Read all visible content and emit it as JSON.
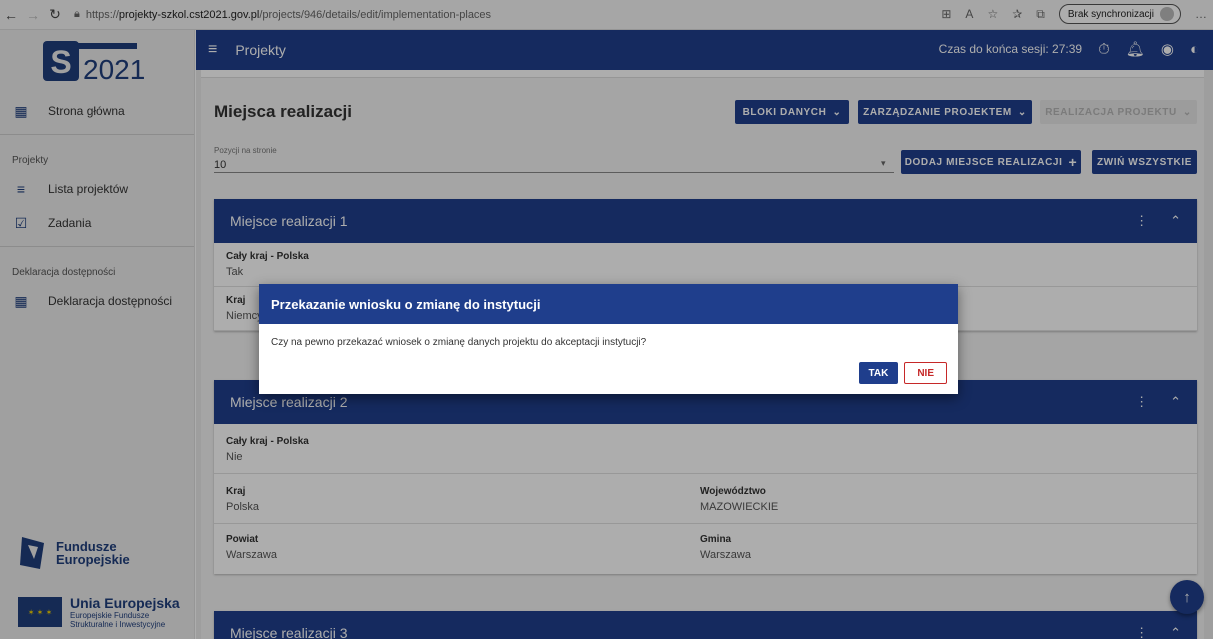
{
  "browser": {
    "url_prefix": "https://",
    "url_host": "projekty-szkol.cst2021.gov.pl",
    "url_path": "/projects/946/details/edit/implementation-places",
    "sync_label": "Brak synchronizacji"
  },
  "sidebar": {
    "logo_text": "2021",
    "items": [
      {
        "label": "Strona główna",
        "icon": "dashboard-icon"
      },
      {
        "label": "Lista projektów",
        "icon": "list-icon"
      },
      {
        "label": "Zadania",
        "icon": "task-icon"
      },
      {
        "label": "Deklaracja dostępności",
        "icon": "dashboard-icon"
      }
    ],
    "sections": [
      "Projekty",
      "Deklaracja dostępności"
    ],
    "fe_logo": {
      "line1": "Fundusze",
      "line2": "Europejskie"
    },
    "ue_logo": {
      "title": "Unia Europejska",
      "sub1": "Europejskie Fundusze",
      "sub2": "Strukturalne i Inwestycyjne"
    }
  },
  "topbar": {
    "title": "Projekty",
    "session_label": "Czas do końca sesji: 27:39"
  },
  "page": {
    "title": "Miejsca realizacji",
    "buttons": {
      "data_blocks": "BLOKI DANYCH",
      "project_management": "ZARZĄDZANIE PROJEKTEM",
      "project_implementation": "REALIZACJA PROJEKTU",
      "add_place": "DODAJ MIEJSCE REALIZACJI",
      "collapse_all": "ZWIŃ WSZYSTKIE"
    },
    "per_page": {
      "label": "Pozycji na stronie",
      "value": "10"
    }
  },
  "cards": [
    {
      "title": "Miejsce realizacji 1",
      "rows": [
        [
          {
            "label": "Cały kraj - Polska",
            "value": "Tak"
          }
        ],
        [
          {
            "label": "Kraj",
            "value": "Niemcy"
          }
        ]
      ]
    },
    {
      "title": "Miejsce realizacji 2",
      "rows": [
        [
          {
            "label": "Cały kraj - Polska",
            "value": "Nie"
          }
        ],
        [
          {
            "label": "Kraj",
            "value": "Polska"
          },
          {
            "label": "Województwo",
            "value": "MAZOWIECKIE"
          }
        ],
        [
          {
            "label": "Powiat",
            "value": "Warszawa"
          },
          {
            "label": "Gmina",
            "value": "Warszawa"
          }
        ]
      ]
    },
    {
      "title": "Miejsce realizacji 3",
      "rows": []
    }
  ],
  "dialog": {
    "title": "Przekazanie wniosku o zmianę do instytucji",
    "message": "Czy na pewno przekazać wniosek o zmianę danych projektu do akceptacji instytucji?",
    "yes_label": "TAK",
    "no_label": "NIE"
  },
  "colors": {
    "primary": "#1f3e8c",
    "danger": "#c62828"
  }
}
